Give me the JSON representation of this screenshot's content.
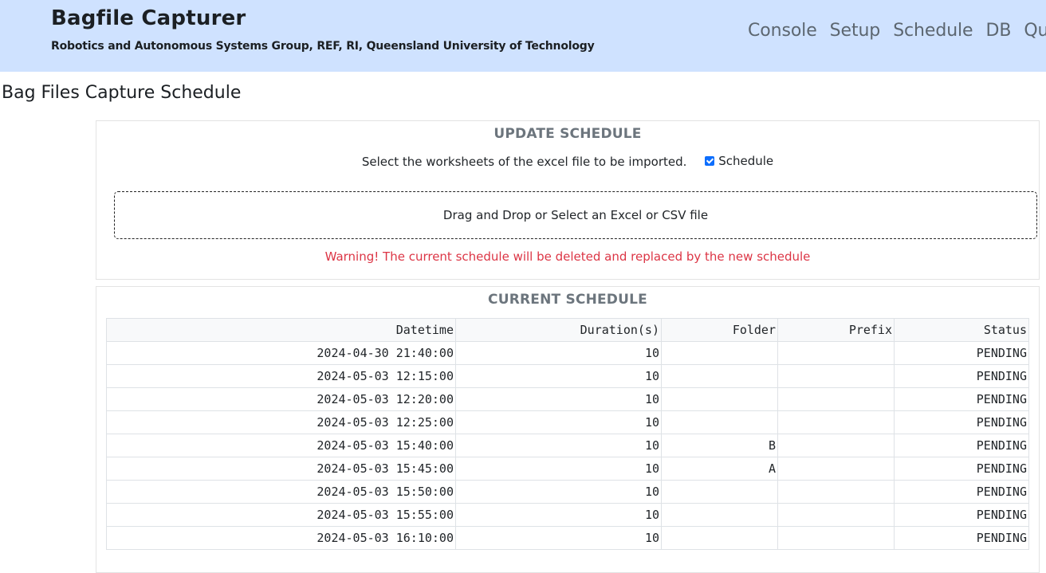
{
  "header": {
    "title": "Bagfile Capturer",
    "subtitle": "Robotics and Autonomous Systems Group, REF, RI, Queensland University of Technology",
    "nav": [
      "Console",
      "Setup",
      "Schedule",
      "DB",
      "Qu"
    ]
  },
  "page": {
    "title": "Bag Files Capture Schedule"
  },
  "update": {
    "heading": "UPDATE SCHEDULE",
    "select_text": "Select the worksheets of the excel file to be imported.",
    "checkbox_label": "Schedule",
    "checkbox_checked": true,
    "dropzone_text": "Drag and Drop or Select an Excel or CSV file",
    "warning": "Warning! The current schedule will be deleted and replaced by the new schedule"
  },
  "schedule": {
    "heading": "CURRENT SCHEDULE",
    "columns": [
      "Datetime",
      "Duration(s)",
      "Folder",
      "Prefix",
      "Status"
    ],
    "rows": [
      [
        "2024-04-30 21:40:00",
        "10",
        "",
        "",
        "PENDING"
      ],
      [
        "2024-05-03 12:15:00",
        "10",
        "",
        "",
        "PENDING"
      ],
      [
        "2024-05-03 12:20:00",
        "10",
        "",
        "",
        "PENDING"
      ],
      [
        "2024-05-03 12:25:00",
        "10",
        "",
        "",
        "PENDING"
      ],
      [
        "2024-05-03 15:40:00",
        "10",
        "B",
        "",
        "PENDING"
      ],
      [
        "2024-05-03 15:45:00",
        "10",
        "A",
        "",
        "PENDING"
      ],
      [
        "2024-05-03 15:50:00",
        "10",
        "",
        "",
        "PENDING"
      ],
      [
        "2024-05-03 15:55:00",
        "10",
        "",
        "",
        "PENDING"
      ],
      [
        "2024-05-03 16:10:00",
        "10",
        "",
        "",
        "PENDING"
      ]
    ]
  }
}
